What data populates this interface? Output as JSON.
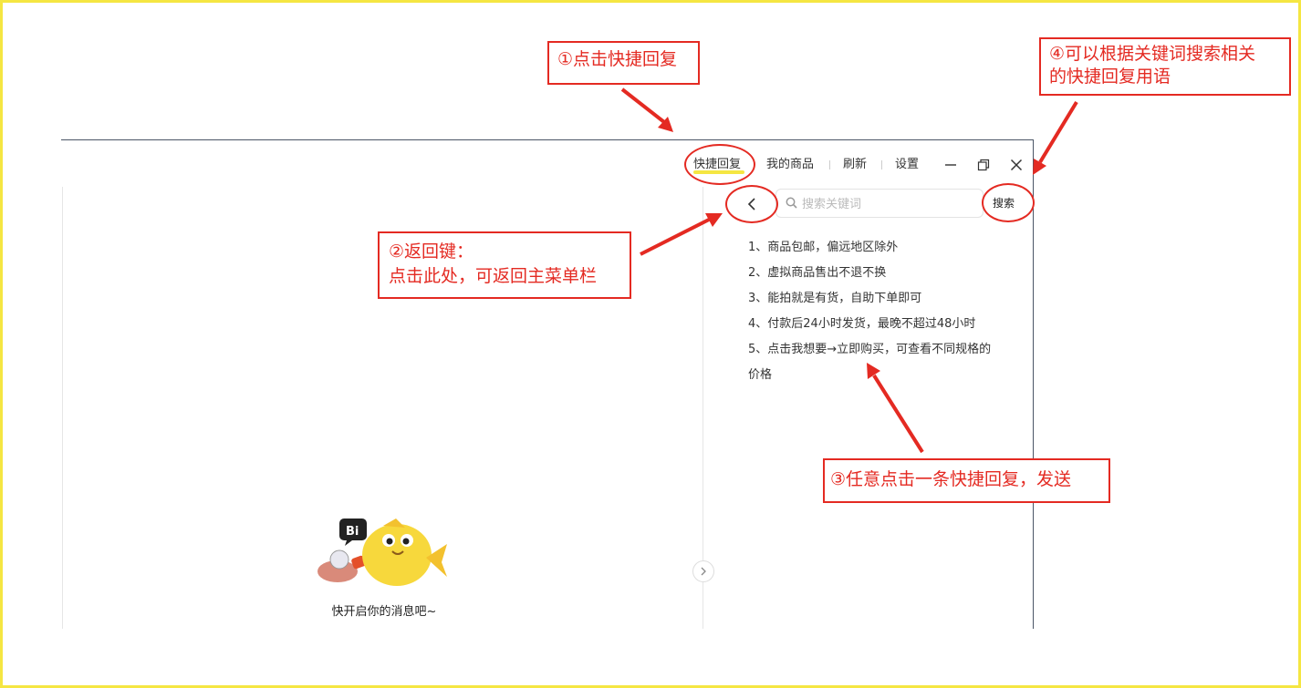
{
  "nav": {
    "quick_reply": "快捷回复",
    "my_products": "我的商品",
    "refresh": "刷新",
    "settings": "设置"
  },
  "window_controls": [
    "minimize-icon",
    "restore-icon",
    "close-icon"
  ],
  "search": {
    "placeholder": "搜索关键词",
    "button": "搜索"
  },
  "quick_replies": [
    "1、商品包邮，偏远地区除外",
    "2、虚拟商品售出不退不换",
    "3、能拍就是有货，自助下单即可",
    "4、付款后24小时发货，最晚不超过48小时",
    "5、点击我想要→立即购买，可查看不同规格的",
    "价格"
  ],
  "empty_state": {
    "bubble_text": "Bi",
    "message": "快开启你的消息吧~"
  },
  "annotations": {
    "step1": "①点击快捷回复",
    "step2_line1": "②返回键：",
    "step2_line2": "点击此处，可返回主菜单栏",
    "step3": "③任意点击一条快捷回复，发送",
    "step4_line1": "④可以根据关键词搜索相关",
    "step4_line2": "的快捷回复用语"
  },
  "colors": {
    "frame": "#f5e642",
    "annotation": "#e42a22",
    "highlight": "#f5e642"
  }
}
